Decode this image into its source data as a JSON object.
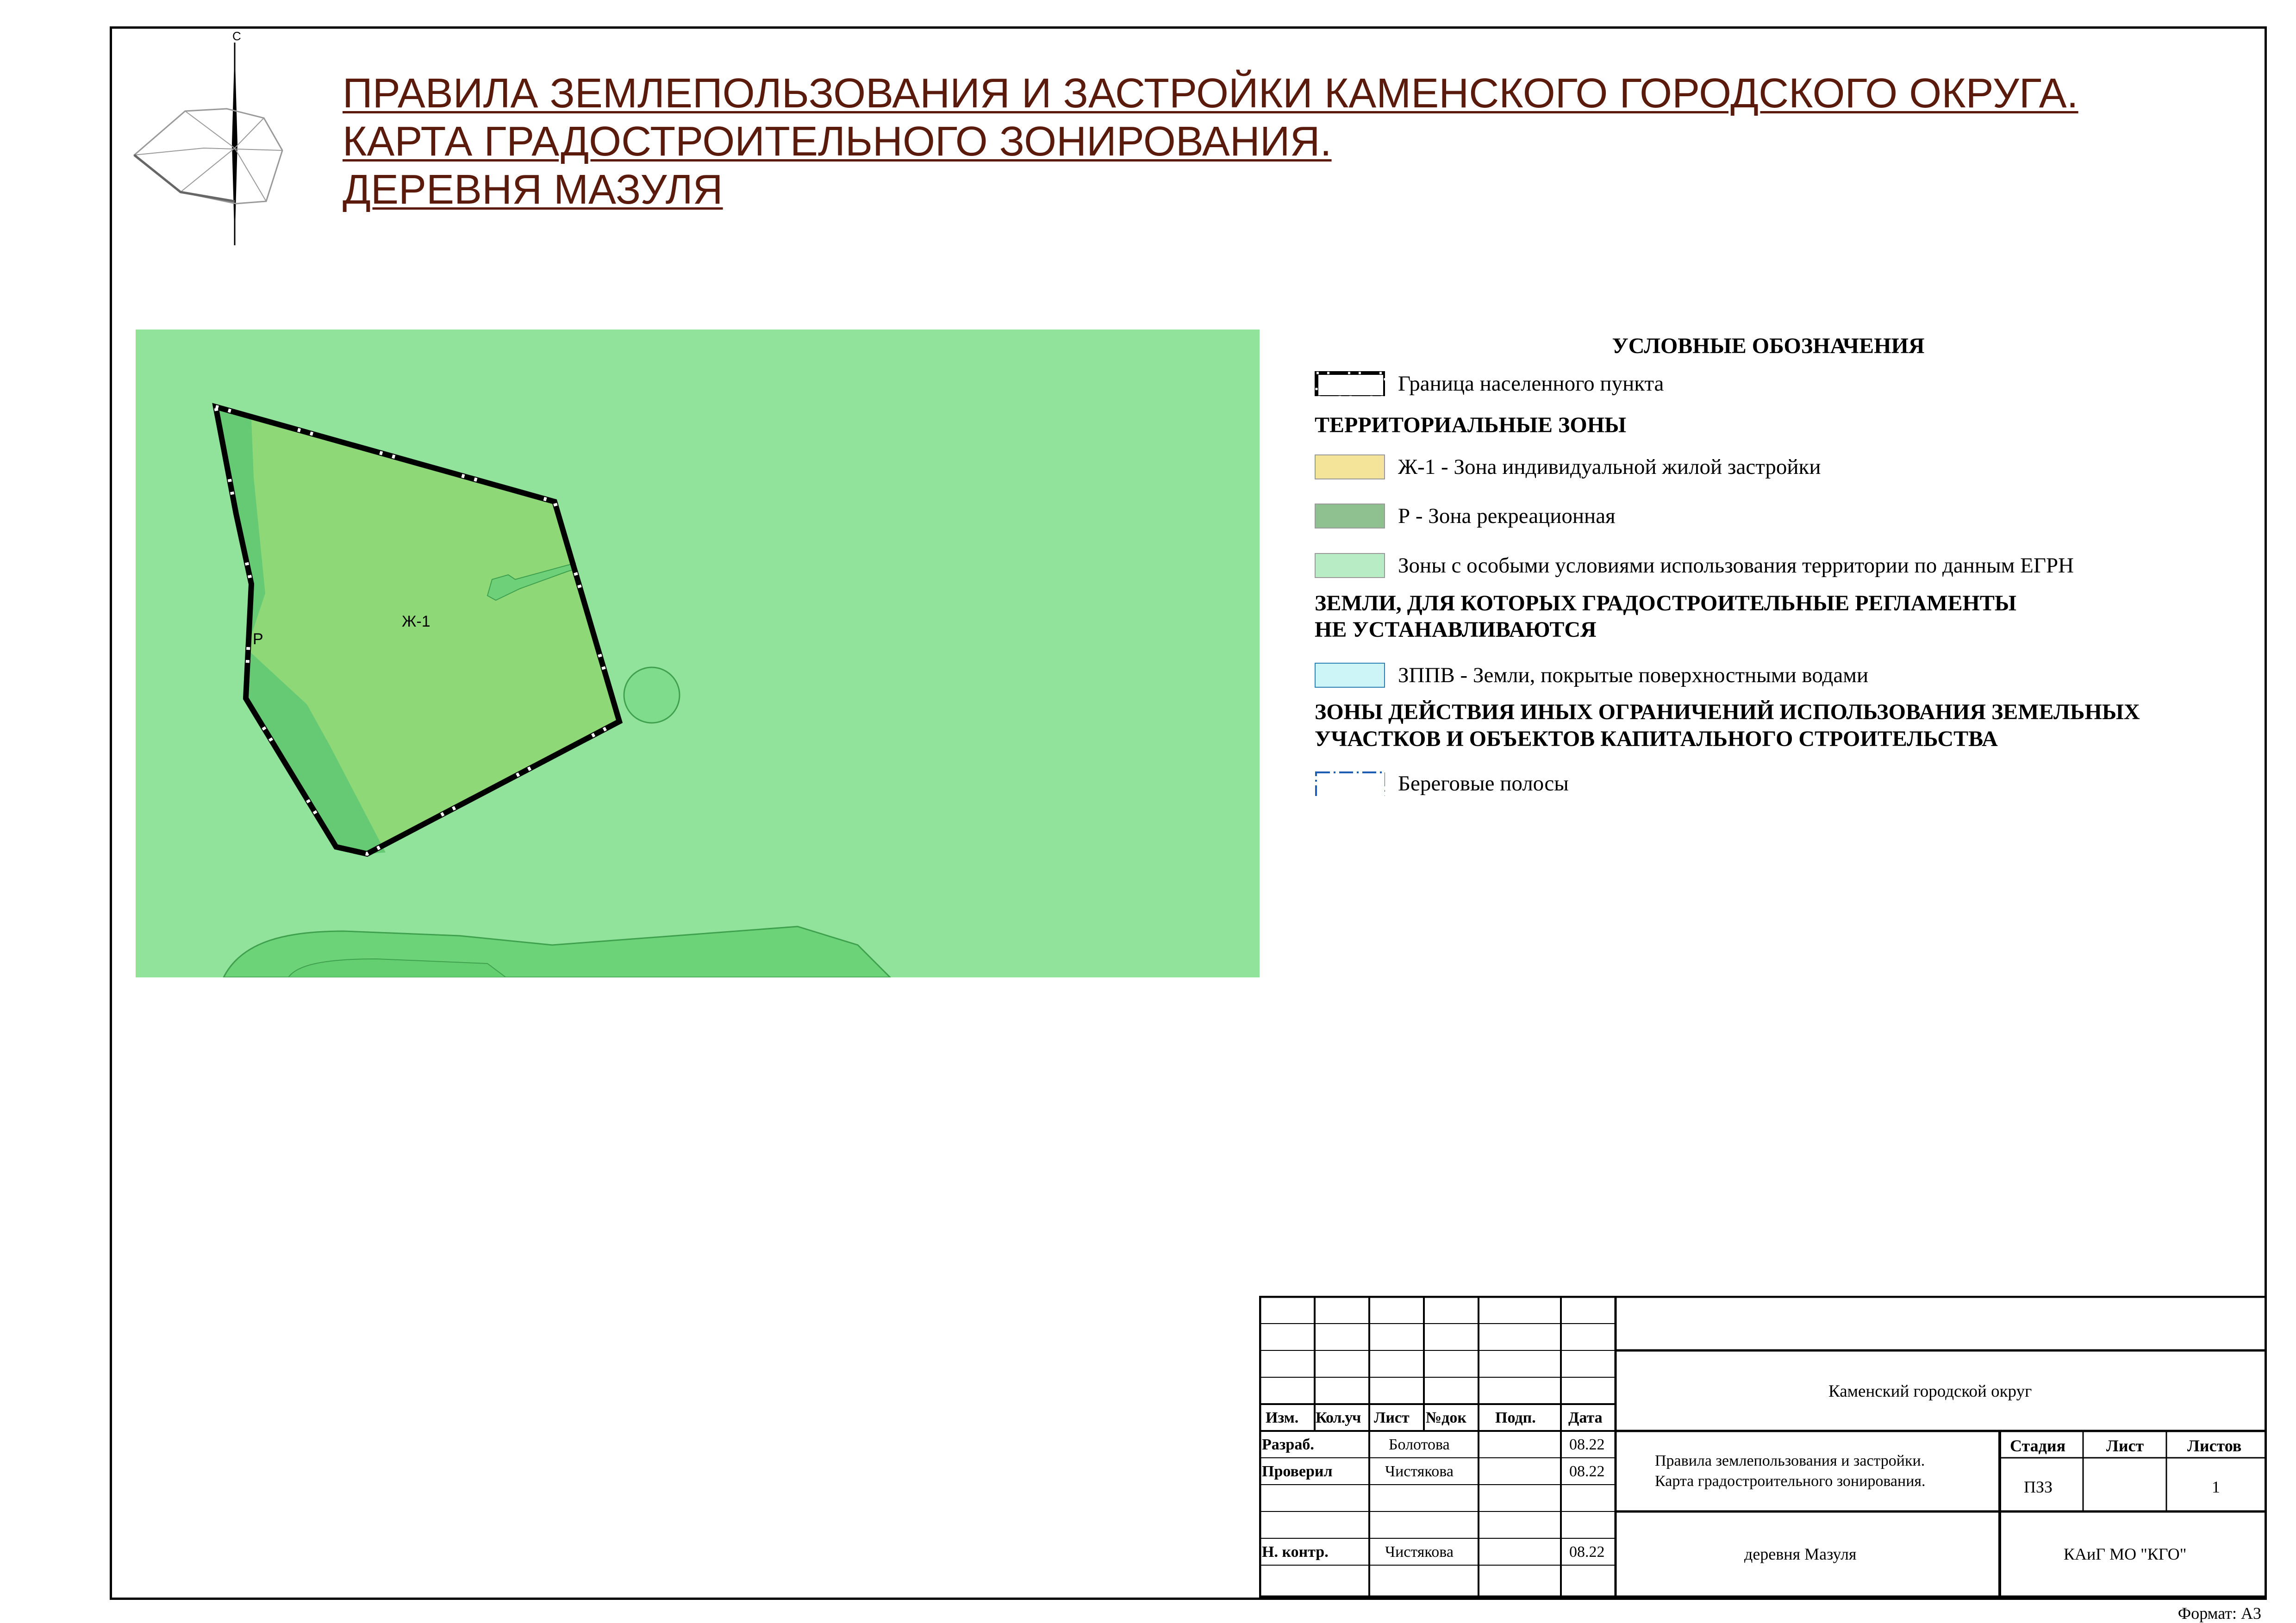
{
  "title": {
    "line1": "ПРАВИЛА ЗЕМЛЕПОЛЬЗОВАНИЯ И ЗАСТРОЙКИ КАМЕНСКОГО ГОРОДСКОГО ОКРУГА.",
    "line2": "КАРТА ГРАДОСТРОИТЕЛЬНОГО ЗОНИРОВАНИЯ.",
    "line3": "ДЕРЕВНЯ МАЗУЛЯ"
  },
  "compass": {
    "north_label": "С"
  },
  "map": {
    "zone_labels": {
      "residential": "Ж-1",
      "recreation": "Р"
    },
    "colors": {
      "background": "#91e39c",
      "residential": "#8ed878",
      "recreation": "#66ca74",
      "pond": "#7fdc8c",
      "boundary": "#000000"
    }
  },
  "legend": {
    "title": "УСЛОВНЫЕ ОБОЗНАЧЕНИЯ",
    "boundary": "Граница населенного пункта",
    "section_zones": "ТЕРРИТОРИАЛЬНЫЕ ЗОНЫ",
    "zh1": "Ж-1 - Зона индивидуальной жилой застройки",
    "r": "Р - Зона рекреационная",
    "zouit": "Зоны с особыми условиями использования территории по данным ЕГРН",
    "section_lands_1": "ЗЕМЛИ, ДЛЯ КОТОРЫХ ГРАДОСТРОИТЕЛЬНЫЕ РЕГЛАМЕНТЫ",
    "section_lands_2": "НЕ УСТАНАВЛИВАЮТСЯ",
    "zppv": "ЗППВ - Земли, покрытые поверхностными водами",
    "section_other_1": "ЗОНЫ ДЕЙСТВИЯ ИНЫХ ОГРАНИЧЕНИЙ ИСПОЛЬЗОВАНИЯ ЗЕМЕЛЬНЫХ",
    "section_other_2": "УЧАСТКОВ И ОБЪЕКТОВ КАПИТАЛЬНОГО СТРОИТЕЛЬСТВА",
    "shore": "Береговые полосы",
    "colors": {
      "zh1": "#f3e49a",
      "r": "#8fc08f",
      "zouit": "#b8ecc4",
      "zppv": "#cdf4f7",
      "shore": "#1f5fb3"
    }
  },
  "stamp": {
    "headers": {
      "izm": "Изм.",
      "kol": "Кол.уч",
      "list": "Лист",
      "ndok": "№док",
      "podp": "Подп.",
      "data": "Дата"
    },
    "rows": [
      {
        "role": "Разраб.",
        "name": "Болотова",
        "date": "08.22"
      },
      {
        "role": "Проверил",
        "name": "Чистякова",
        "date": "08.22"
      },
      {
        "role": "Н. контр.",
        "name": "Чистякова",
        "date": "08.22"
      }
    ],
    "org": "Каменский городской округ",
    "doc_line1": "Правила землепользования и застройки.",
    "doc_line2": "Карта градостроительного зонирования.",
    "stage_label": "Стадия",
    "sheet_label": "Лист",
    "sheets_label": "Листов",
    "stage": "ПЗЗ",
    "sheets": "1",
    "place": "деревня Мазуля",
    "developer": "КАиГ МО \"КГО\""
  },
  "format": "Формат: А3"
}
